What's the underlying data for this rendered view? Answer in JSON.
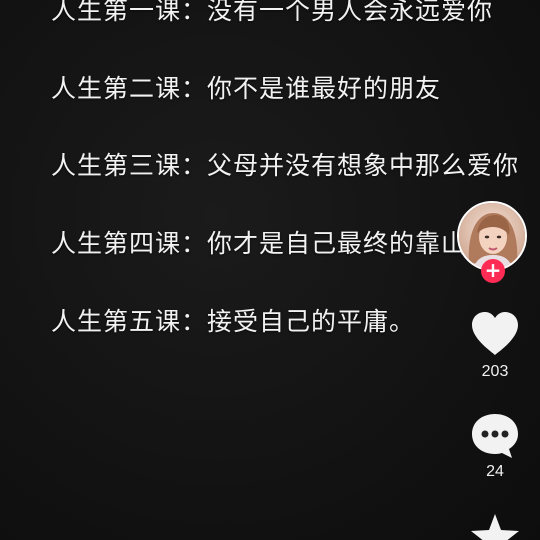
{
  "captions": {
    "lesson_1": "人生第一课：没有一个男人会永远爱你",
    "lesson_2": "人生第二课：你不是谁最好的朋友",
    "lesson_3": "人生第三课：父母并没有想象中那么爱你",
    "lesson_4": "人生第四课：你才是自己最终的靠山",
    "lesson_5": "人生第五课：接受自己的平庸。"
  },
  "actions": {
    "follow_label": "+",
    "like_count": "203",
    "comment_count": "24"
  },
  "icons": {
    "avatar": "creator-avatar",
    "follow": "plus-icon",
    "like": "heart-icon",
    "comment": "comment-bubble-icon",
    "favorite": "star-icon"
  },
  "colors": {
    "accent": "#fe2c55",
    "icon": "#ffffff",
    "background": "#121212"
  }
}
